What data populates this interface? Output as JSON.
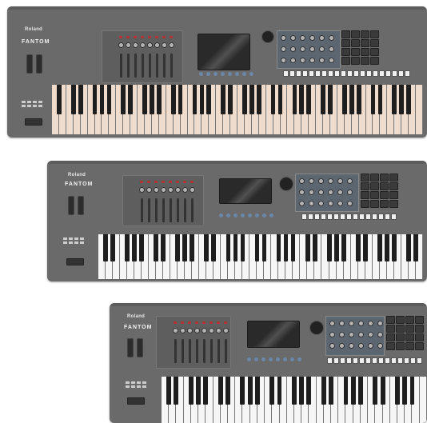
{
  "keyboards": [
    {
      "brand": "Roland",
      "model": "FANTOM",
      "variant": "88-key",
      "key_color": "#efdccc",
      "has_red_felt": true
    },
    {
      "brand": "Roland",
      "model": "FANTOM",
      "variant": "76-key",
      "key_color": "#f6f6f6",
      "has_red_felt": false
    },
    {
      "brand": "Roland",
      "model": "FANTOM",
      "variant": "61-key",
      "key_color": "#f6f6f6",
      "has_red_felt": false
    }
  ],
  "colors": {
    "body": "#6a6a6a",
    "accent_red": "#b33333",
    "accent_blue": "#6a87a8"
  }
}
